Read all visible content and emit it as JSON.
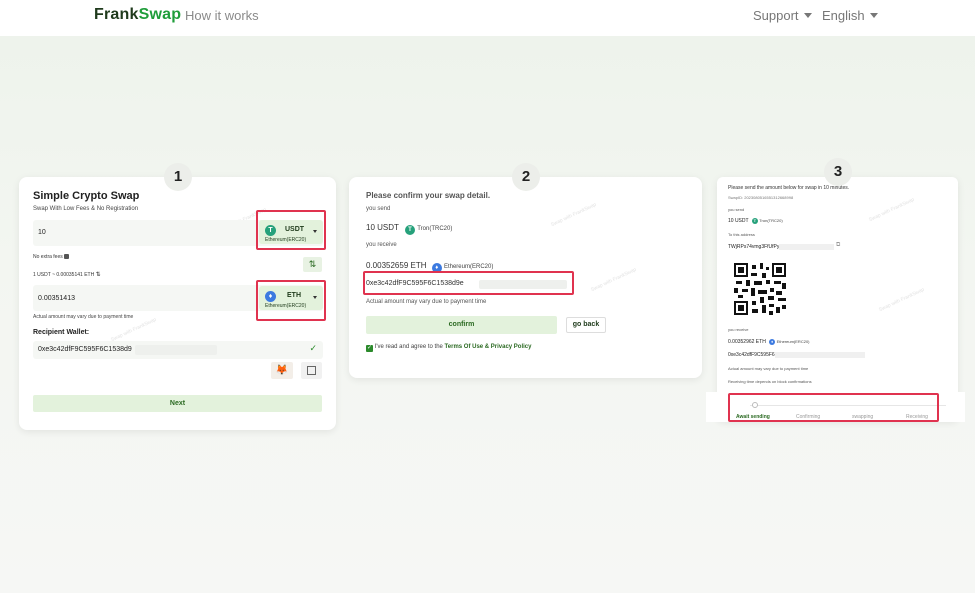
{
  "nav": {
    "logo_part1": "Frank",
    "logo_part2": "Swap",
    "how_it_works": "How it works",
    "support": "Support",
    "language": "English"
  },
  "steps": [
    "1",
    "2",
    "3"
  ],
  "card1": {
    "title": "Simple Crypto Swap",
    "subtitle": "Swap With Low Fees & No Registration",
    "send_amount": "10",
    "send_coin": "USDT",
    "send_network": "Ethereum(ERC20)",
    "fees_text": "No extra fees",
    "rate_text": "1 USDT ~ 0.00035141 ETH",
    "receive_amount": "0.00351413",
    "receive_coin": "ETH",
    "receive_network": "Ethereum(ERC20)",
    "vary_note": "Actual amount may vary due to payment time",
    "wallet_label": "Recipient Wallet:",
    "wallet_value": "0xe3c42dfF9C595F6C1538d9",
    "next_label": "Next"
  },
  "card2": {
    "title": "Please confirm your swap detail.",
    "you_send_label": "you send",
    "send_amount": "10 USDT",
    "send_network": "Tron(TRC20)",
    "you_receive_label": "you receive",
    "receive_amount": "0.00352659 ETH",
    "receive_network": "Ethereum(ERC20)",
    "address": "0xe3c42dfF9C595F6C1538d9e",
    "vary_note": "Actual amount may vary due to payment time",
    "confirm_label": "confirm",
    "go_back_label": "go back",
    "agree_prefix": "I've read and agree to the",
    "agree_link": "Terms Of Use & Privacy Policy"
  },
  "card3": {
    "title": "Please send the amount below for swap in 10 minutes.",
    "swap_id": "SwapID: 2023080516551312668998",
    "you_send_label": "you send",
    "send_amount": "10 USDT",
    "send_network": "Tron(TRC20)",
    "to_address_label": "To this address",
    "deposit_address": "TWjRPs74vmg3FfUfPynQ",
    "you_receive_label": "you receive",
    "receive_amount": "0.00352962 ETH",
    "receive_network": "Ethereum(ERC20)",
    "recipient": "0xe3c42dfF9C595F6",
    "vary_note": "Actual amount may vary due to payment time",
    "receiving_note": "Receiving time depends on block confirmations",
    "progress": [
      "Await sending",
      "Confirming",
      "swapping",
      "Receiving"
    ]
  },
  "watermark": "Swap with FrankSwap",
  "colors": {
    "brand_green": "#1f9d3a",
    "highlight_red": "#e0334f",
    "button_green": "#e3f2dc",
    "usdt": "#26a17b",
    "eth": "#3c7ae0"
  }
}
